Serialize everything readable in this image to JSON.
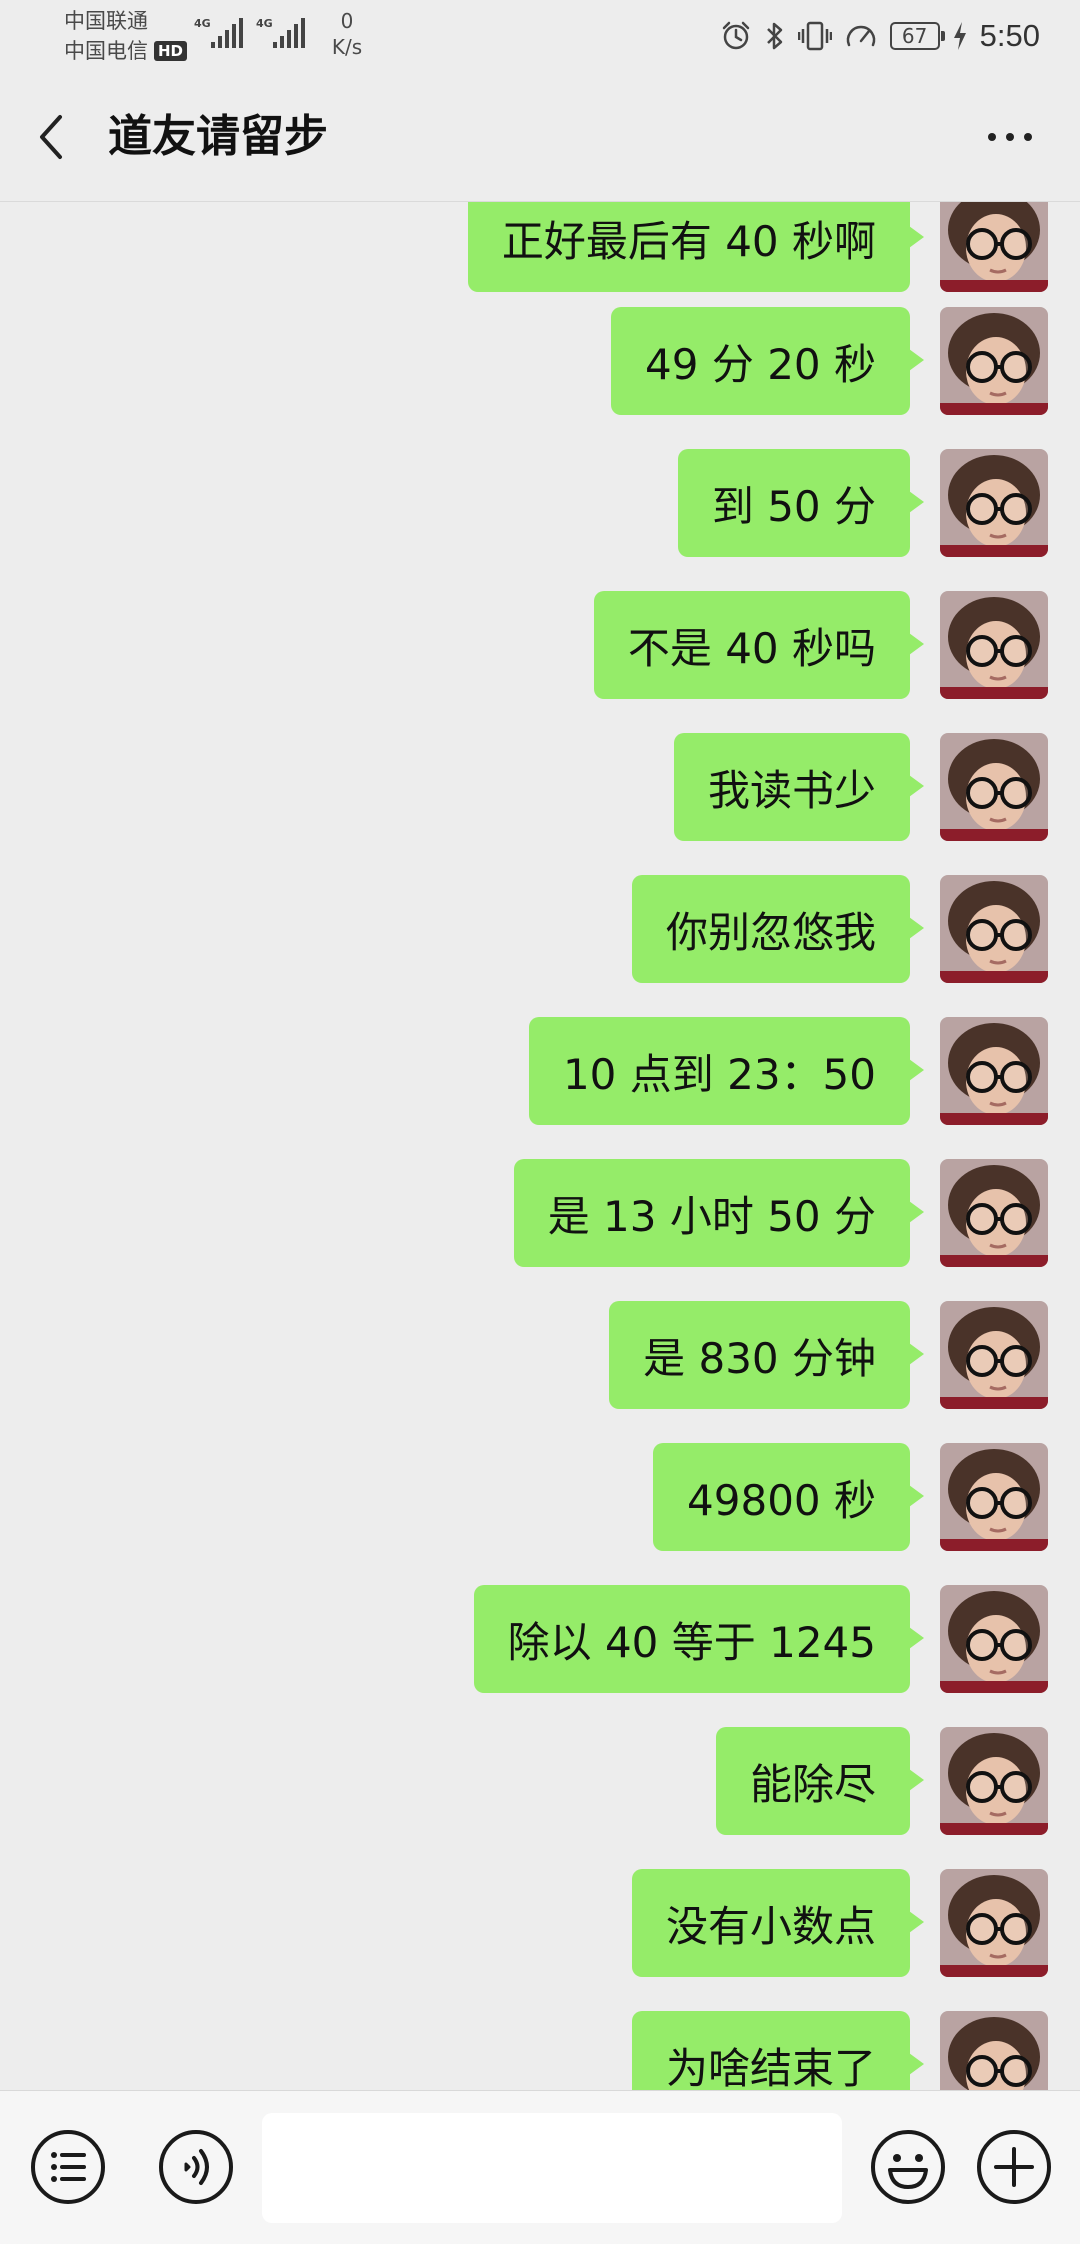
{
  "status_bar": {
    "carrier_1": "中国联通",
    "carrier_2": "中国电信",
    "hd_badge": "HD",
    "network_1": "4G",
    "network_2": "4G",
    "speed_value": "0",
    "speed_unit": "K/s",
    "battery_level": "67",
    "time": "5:50",
    "icons": [
      "alarm-icon",
      "bluetooth-icon",
      "vibrate-icon",
      "speed-gauge-icon",
      "battery-icon",
      "charging-icon"
    ]
  },
  "header": {
    "title": "道友请留步",
    "back_icon": "chevron-left-icon",
    "more_icon": "more-dots-icon"
  },
  "messages": [
    {
      "text": "正好最后有 40 秒啊"
    },
    {
      "text": "49 分 20 秒"
    },
    {
      "text": "到 50 分"
    },
    {
      "text": "不是 40 秒吗"
    },
    {
      "text": "我读书少"
    },
    {
      "text": "你别忽悠我"
    },
    {
      "text": "10 点到 23：50"
    },
    {
      "text": "是 13 小时 50 分"
    },
    {
      "text": "是 830 分钟"
    },
    {
      "text": "49800 秒"
    },
    {
      "text": "除以 40 等于 1245"
    },
    {
      "text": "能除尽"
    },
    {
      "text": "没有小数点"
    },
    {
      "text": "为啥结束了"
    }
  ],
  "input_bar": {
    "message_value": "",
    "icons": [
      "menu-list-icon",
      "voice-icon",
      "emoji-icon",
      "plus-icon"
    ]
  },
  "colors": {
    "background": "#ededed",
    "bubble_outgoing": "#95ec69",
    "input_bar": "#f6f6f6"
  }
}
